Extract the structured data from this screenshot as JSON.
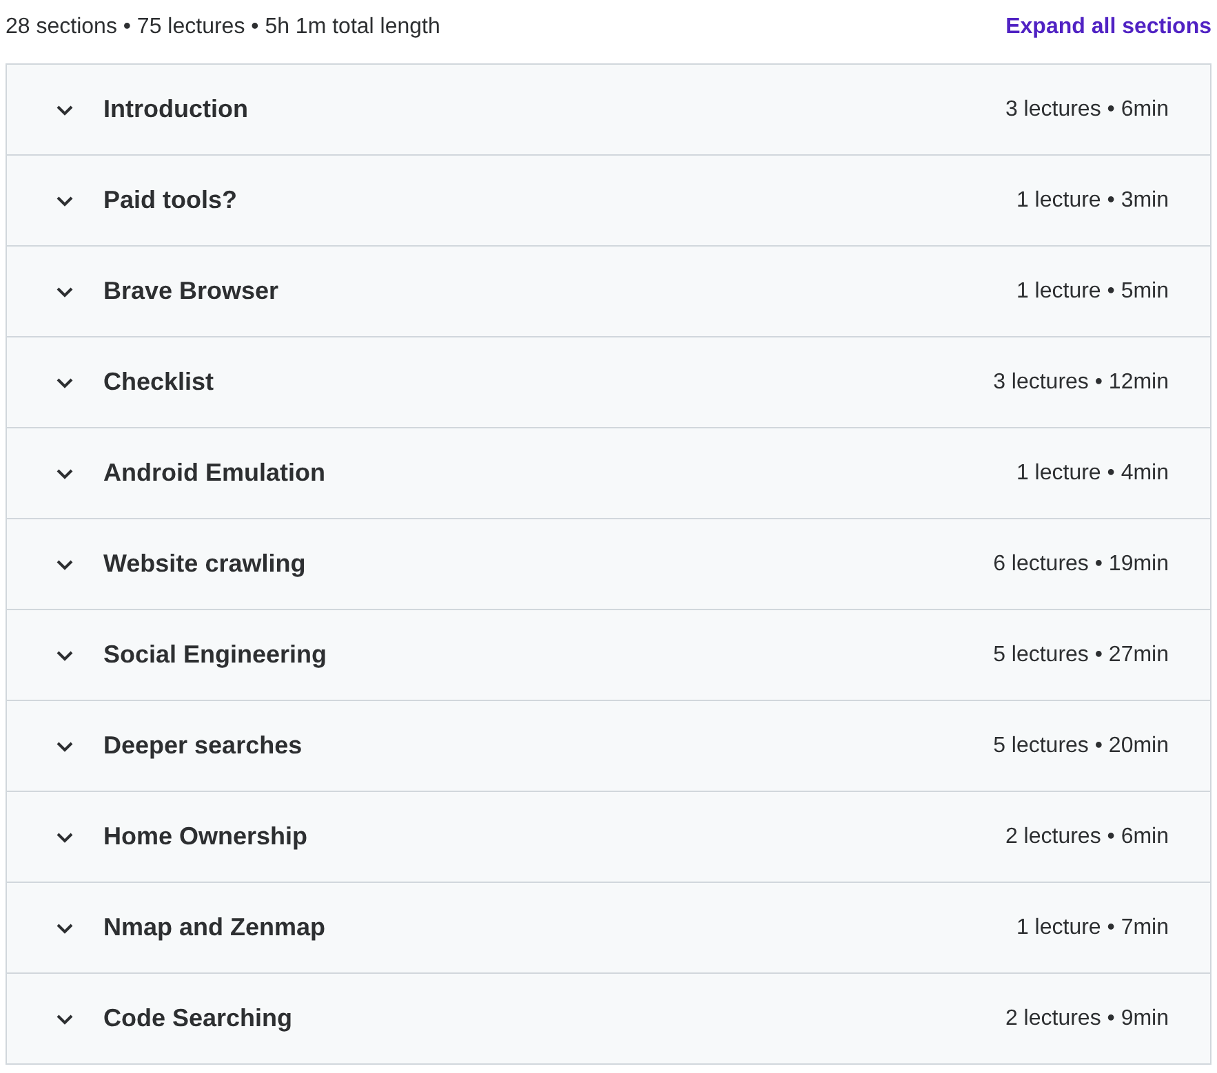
{
  "summary": "28 sections • 75 lectures • 5h 1m total length",
  "expand_all_link": "Expand all sections",
  "sections": [
    {
      "title": "Introduction",
      "meta": "3 lectures • 6min",
      "expanded": false
    },
    {
      "title": "Paid tools?",
      "meta": "1 lecture • 3min",
      "expanded": false
    },
    {
      "title": "Brave Browser",
      "meta": "1 lecture • 5min",
      "expanded": false
    },
    {
      "title": "Checklist",
      "meta": "3 lectures • 12min",
      "expanded": false
    },
    {
      "title": "Android Emulation",
      "meta": "1 lecture • 4min",
      "expanded": false
    },
    {
      "title": "Website crawling",
      "meta": "6 lectures • 19min",
      "expanded": false
    },
    {
      "title": "Social Engineering",
      "meta": "5 lectures • 27min",
      "expanded": false
    },
    {
      "title": "Deeper searches",
      "meta": "5 lectures • 20min",
      "expanded": false
    },
    {
      "title": "Home Ownership",
      "meta": "2 lectures • 6min",
      "expanded": false
    },
    {
      "title": "Nmap and Zenmap",
      "meta": "1 lecture • 7min",
      "expanded": false
    },
    {
      "title": "Code Searching",
      "meta": "2 lectures • 9min",
      "expanded": false
    }
  ]
}
